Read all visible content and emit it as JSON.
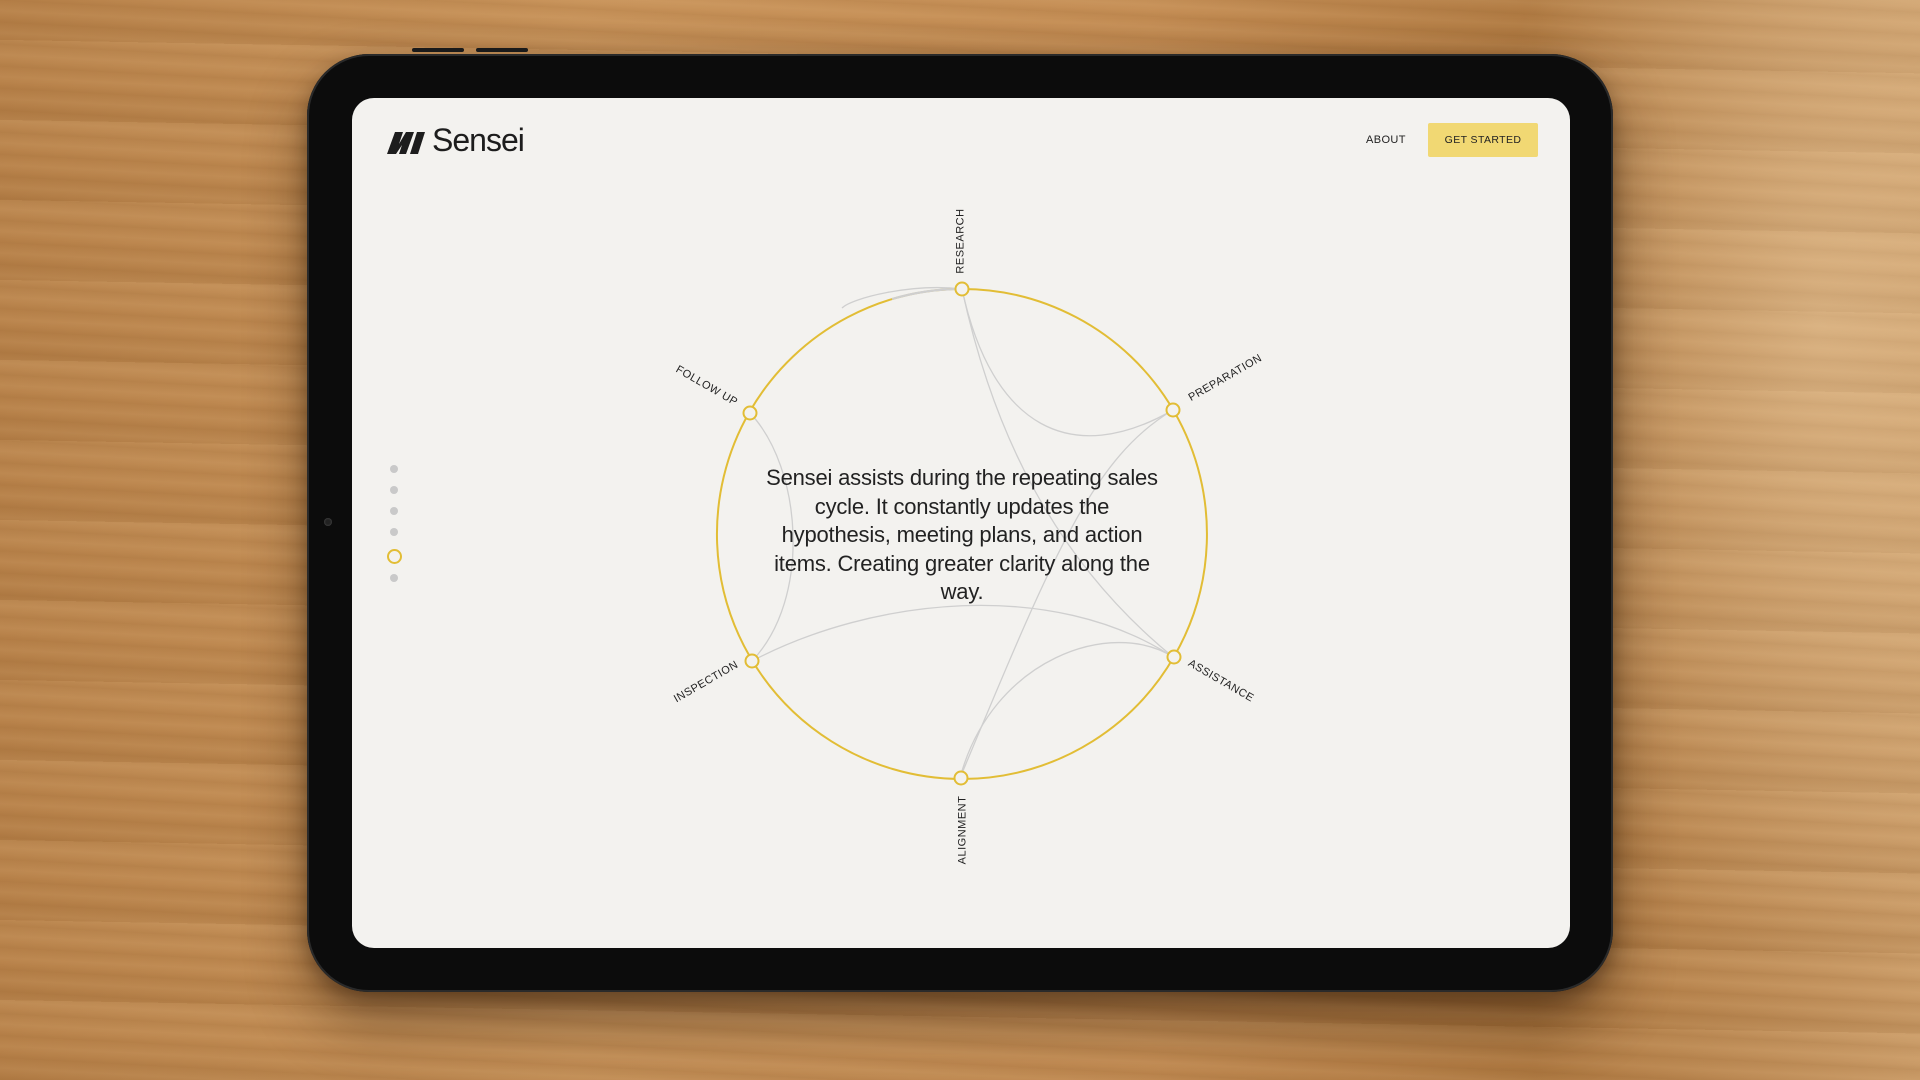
{
  "app": {
    "brand": "Sensei"
  },
  "nav": {
    "about": "ABOUT",
    "cta": "GET STARTED"
  },
  "pager": {
    "count": 6,
    "active_index": 4
  },
  "cycle": {
    "description": "Sensei assists during the repeating sales cycle. It constantly updates the hypothesis, meeting plans, and action items. Creating greater clarity along the way.",
    "stages": [
      "RESEARCH",
      "PREPARATION",
      "ASSISTANCE",
      "ALIGNMENT",
      "INSPECTION",
      "FOLLOW UP"
    ]
  },
  "colors": {
    "accent": "#e2bd35",
    "cta_bg": "#f1d873",
    "screen_bg": "#f3f2ef",
    "connector": "#cfcfcf"
  }
}
